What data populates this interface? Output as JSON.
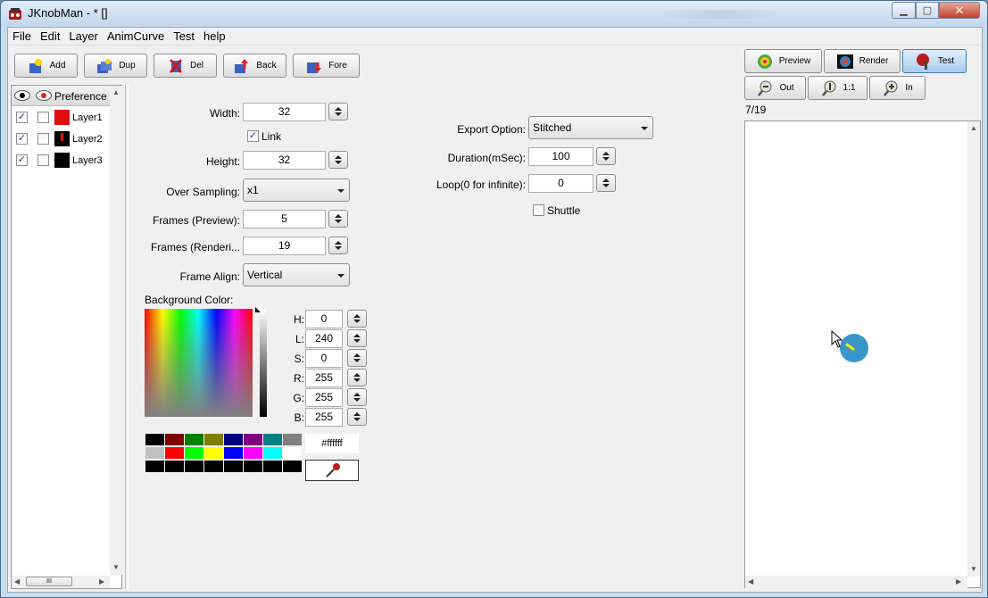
{
  "window": {
    "title": "JKnobMan - * []"
  },
  "menu": [
    "File",
    "Edit",
    "Layer",
    "AnimCurve",
    "Test",
    "help"
  ],
  "toolbar": {
    "add": "Add",
    "dup": "Dup",
    "del": "Del",
    "back": "Back",
    "fore": "Fore"
  },
  "layers": {
    "header": "Preference",
    "items": [
      {
        "label": "Layer1",
        "checked": true
      },
      {
        "label": "Layer2",
        "checked": true
      },
      {
        "label": "Layer3",
        "checked": true
      }
    ]
  },
  "prefs": {
    "width_label": "Width:",
    "width": "32",
    "link_label": "Link",
    "height_label": "Height:",
    "height": "32",
    "oversampling_label": "Over Sampling:",
    "oversampling": "x1",
    "frames_preview_label": "Frames (Preview):",
    "frames_preview": "5",
    "frames_render_label": "Frames (Renderi...",
    "frames_render": "19",
    "frame_align_label": "Frame Align:",
    "frame_align": "Vertical",
    "bg_color_label": "Background Color:",
    "export_label": "Export Option:",
    "export": "Stitched",
    "duration_label": "Duration(mSec):",
    "duration": "100",
    "loop_label": "Loop(0 for infinite):",
    "loop": "0",
    "shuttle_label": "Shuttle"
  },
  "color": {
    "h_label": "H:",
    "h": "0",
    "l_label": "L:",
    "l": "240",
    "s_label": "S:",
    "s": "0",
    "r_label": "R:",
    "r": "255",
    "g_label": "G:",
    "g": "255",
    "b_label": "B:",
    "b": "255",
    "hex": "#ffffff",
    "palette_row1": [
      "#000000",
      "#800000",
      "#008000",
      "#808000",
      "#000080",
      "#800080",
      "#008080",
      "#808080"
    ],
    "palette_row2": [
      "#c0c0c0",
      "#ff0000",
      "#00ff00",
      "#ffff00",
      "#0000ff",
      "#ff00ff",
      "#00ffff",
      "#ffffff"
    ],
    "palette_row3": [
      "#000000",
      "#000000",
      "#000000",
      "#000000",
      "#000000",
      "#000000",
      "#000000",
      "#000000"
    ]
  },
  "preview": {
    "preview_btn": "Preview",
    "render_btn": "Render",
    "test_btn": "Test",
    "out_btn": "Out",
    "one_btn": "1:1",
    "in_btn": "In",
    "frame": "7/19",
    "knob_color": "#3a96c9"
  }
}
